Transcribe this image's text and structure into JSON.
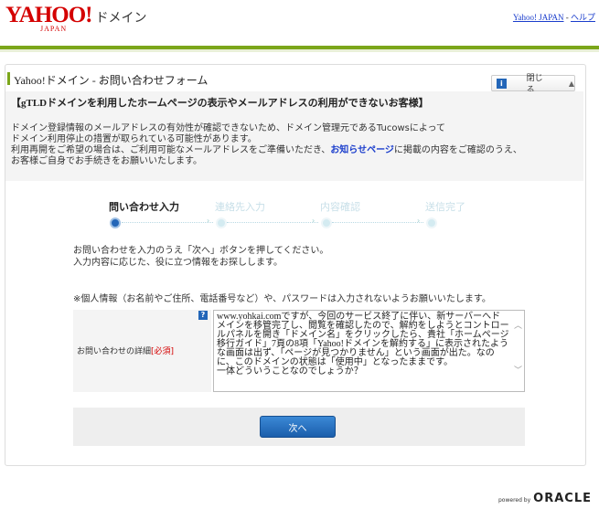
{
  "header": {
    "logo_text": "YAHOO!",
    "logo_sub": "JAPAN",
    "service_name": "ドメイン",
    "links": [
      {
        "label": "Yahoo! JAPAN"
      },
      {
        "label": "ヘルプ"
      }
    ],
    "link_separator": " - "
  },
  "form": {
    "title": "Yahoo!ドメイン - お問い合わせフォーム",
    "close_label": "閉じる",
    "notice": {
      "heading": "【gTLDドメインを利用したホームページの表示やメールアドレスの利用ができないお客様】",
      "lines": [
        "ドメイン登録情報のメールアドレスの有効性が確認できないため、ドメイン管理元であるTucowsによって",
        "ドメイン利用停止の措置が取られている可能性があります。",
        "利用再開をご希望の場合は、ご利用可能なメールアドレスをご準備いただき、"
      ],
      "link_text": "お知らせページ",
      "line3_suffix": "に掲載の内容をご確認のうえ、",
      "line4": "お客様ご自身でお手続きをお願いいたします。"
    },
    "steps": [
      {
        "label": "問い合わせ入力",
        "active": true
      },
      {
        "label": "連絡先入力",
        "active": false
      },
      {
        "label": "内容確認",
        "active": false
      },
      {
        "label": "送信完了",
        "active": false
      }
    ],
    "instructions": [
      "お問い合わせを入力のうえ「次へ」ボタンを押してください。",
      "入力内容に応じた、役に立つ情報をお探しします。"
    ],
    "privacy_note": "※個人情報（お名前やご住所、電話番号など）や、パスワードは入力されないようお願いいたします。",
    "field": {
      "label": "お問い合わせの詳細",
      "required": "[必須]",
      "value": "www.yohkai.comですが、今回のサービス終了に伴い、新サーバーへドメインを移管完了し、閲覧を確認したので、解約をしようとコントロールパネルを開き「ドメイン名」をクリックしたら、貴社「ホームページ移行ガイド」7頁の8項「Yahoo!ドメインを解約する」に表示されたような画面は出ず、「ページが見つかりません」という画面が出た。なのに、このドメインの状態は「使用中」となったままです。\n一体どういうことなのでしょうか？"
    },
    "next_label": "次へ"
  },
  "footer": {
    "powered_by": "powered by",
    "brand": "ORACLE"
  },
  "colors": {
    "accent_green": "#7ba61a",
    "brand_red": "#d40000",
    "link_blue": "#1a3dcc",
    "button_blue": "#2366b8"
  }
}
